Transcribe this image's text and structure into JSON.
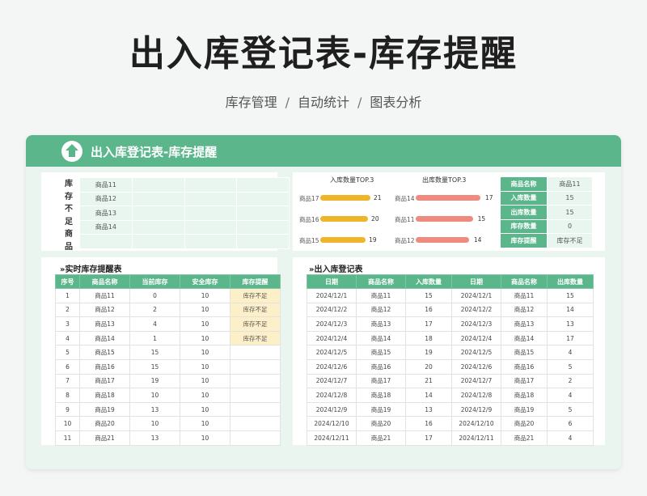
{
  "page": {
    "title": "出入库登记表-库存提醒",
    "subtitle": [
      "库存管理",
      "自动统计",
      "图表分析"
    ],
    "separator": "/"
  },
  "card": {
    "header_title": "出入库登记表-库存提醒",
    "header_icon": "home-icon",
    "accent_color": "#5cb68c"
  },
  "shortage": {
    "label_chars": [
      "库",
      "存",
      "不",
      "足",
      "商",
      "品"
    ],
    "rows": [
      [
        "商品11",
        "",
        "",
        ""
      ],
      [
        "商品12",
        "",
        "",
        ""
      ],
      [
        "商品13",
        "",
        "",
        ""
      ],
      [
        "商品14",
        "",
        "",
        ""
      ],
      [
        "",
        "",
        "",
        ""
      ]
    ]
  },
  "charts": {
    "in_title": "入库数量TOP.3",
    "out_title": "出库数量TOP.3",
    "in_color": "#f0b429",
    "out_color": "#ee8b7e",
    "in_top": [
      {
        "name": "商品17",
        "value": 21
      },
      {
        "name": "商品16",
        "value": 20
      },
      {
        "name": "商品15",
        "value": 19
      }
    ],
    "out_top": [
      {
        "name": "商品14",
        "value": 17
      },
      {
        "name": "商品11",
        "value": 15
      },
      {
        "name": "商品12",
        "value": 14
      }
    ]
  },
  "summary": [
    {
      "key": "商品名称",
      "value": "商品11"
    },
    {
      "key": "入库数量",
      "value": "15"
    },
    {
      "key": "出库数量",
      "value": "15"
    },
    {
      "key": "库存数量",
      "value": "0"
    },
    {
      "key": "库存提醒",
      "value": "库存不足"
    }
  ],
  "alert_table": {
    "title": "»实时库存提醒表",
    "headers": [
      "序号",
      "商品名称",
      "当前库存",
      "安全库存",
      "库存提醒"
    ],
    "rows": [
      [
        "1",
        "商品11",
        "0",
        "10",
        "库存不足"
      ],
      [
        "2",
        "商品12",
        "2",
        "10",
        "库存不足"
      ],
      [
        "3",
        "商品13",
        "4",
        "10",
        "库存不足"
      ],
      [
        "4",
        "商品14",
        "1",
        "10",
        "库存不足"
      ],
      [
        "5",
        "商品15",
        "15",
        "10",
        ""
      ],
      [
        "6",
        "商品16",
        "15",
        "10",
        ""
      ],
      [
        "7",
        "商品17",
        "19",
        "10",
        ""
      ],
      [
        "8",
        "商品18",
        "10",
        "10",
        ""
      ],
      [
        "9",
        "商品19",
        "13",
        "10",
        ""
      ],
      [
        "10",
        "商品20",
        "10",
        "10",
        ""
      ],
      [
        "11",
        "商品21",
        "13",
        "10",
        ""
      ]
    ]
  },
  "log_table": {
    "title": "»出入库登记表",
    "headers": [
      "日期",
      "商品名称",
      "入库数量",
      "日期",
      "商品名称",
      "出库数量"
    ],
    "rows": [
      [
        "2024/12/1",
        "商品11",
        "15",
        "2024/12/1",
        "商品11",
        "15"
      ],
      [
        "2024/12/2",
        "商品12",
        "16",
        "2024/12/2",
        "商品12",
        "14"
      ],
      [
        "2024/12/3",
        "商品13",
        "17",
        "2024/12/3",
        "商品13",
        "13"
      ],
      [
        "2024/12/4",
        "商品14",
        "18",
        "2024/12/4",
        "商品14",
        "17"
      ],
      [
        "2024/12/5",
        "商品15",
        "19",
        "2024/12/5",
        "商品15",
        "4"
      ],
      [
        "2024/12/6",
        "商品16",
        "20",
        "2024/12/6",
        "商品16",
        "5"
      ],
      [
        "2024/12/7",
        "商品17",
        "21",
        "2024/12/7",
        "商品17",
        "2"
      ],
      [
        "2024/12/8",
        "商品18",
        "14",
        "2024/12/8",
        "商品18",
        "4"
      ],
      [
        "2024/12/9",
        "商品19",
        "13",
        "2024/12/9",
        "商品19",
        "5"
      ],
      [
        "2024/12/10",
        "商品20",
        "16",
        "2024/12/10",
        "商品20",
        "6"
      ],
      [
        "2024/12/11",
        "商品21",
        "17",
        "2024/12/11",
        "商品21",
        "4"
      ]
    ]
  }
}
